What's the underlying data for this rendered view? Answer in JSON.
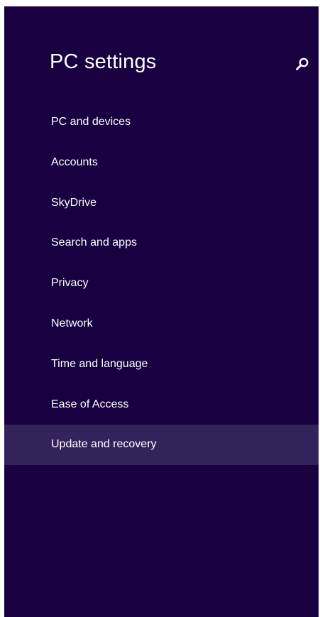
{
  "window": {
    "title": "PC settings",
    "background_color": "#180041",
    "selected_color": "#34235b"
  },
  "search": {
    "icon": "search-icon"
  },
  "nav": {
    "items": [
      {
        "label": "PC and devices",
        "selected": false
      },
      {
        "label": "Accounts",
        "selected": false
      },
      {
        "label": "SkyDrive",
        "selected": false
      },
      {
        "label": "Search and apps",
        "selected": false
      },
      {
        "label": "Privacy",
        "selected": false
      },
      {
        "label": "Network",
        "selected": false
      },
      {
        "label": "Time and language",
        "selected": false
      },
      {
        "label": "Ease of Access",
        "selected": false
      },
      {
        "label": "Update and recovery",
        "selected": true
      }
    ]
  }
}
